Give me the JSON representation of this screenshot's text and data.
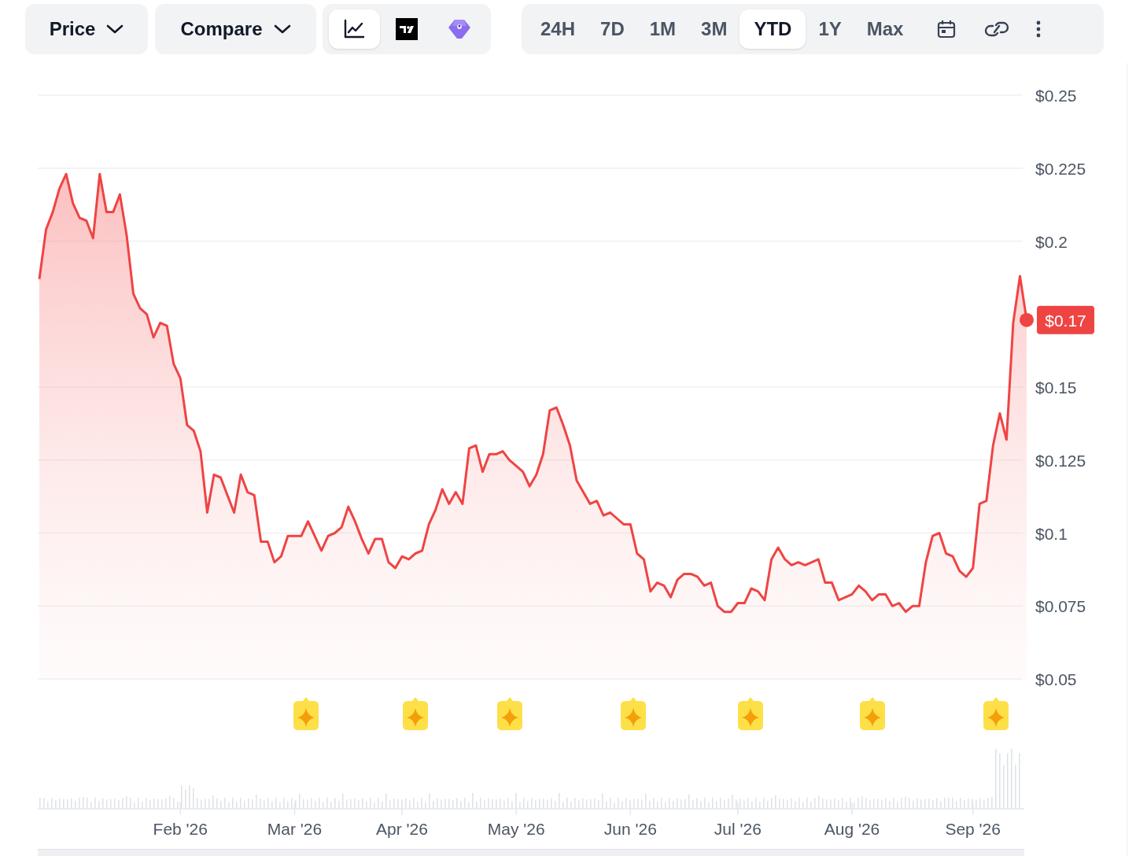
{
  "toolbar": {
    "price_dropdown": {
      "label": "Price"
    },
    "compare_dropdown": {
      "label": "Compare"
    },
    "view_modes": [
      {
        "selected": true
      },
      {
        "selected": false
      },
      {
        "selected": false
      }
    ],
    "ranges": [
      {
        "label": "24H",
        "selected": false
      },
      {
        "label": "7D",
        "selected": false
      },
      {
        "label": "1M",
        "selected": false
      },
      {
        "label": "3M",
        "selected": false
      },
      {
        "label": "YTD",
        "selected": true
      },
      {
        "label": "1Y",
        "selected": false
      },
      {
        "label": "Max",
        "selected": false
      }
    ]
  },
  "chart": {
    "current_price_label": "$0.17",
    "chart_data": {
      "type": "area",
      "grid": true,
      "ylim": [
        0.05,
        0.25
      ],
      "yticks": [
        {
          "value": 0.05,
          "label": "$0.05"
        },
        {
          "value": 0.075,
          "label": "$0.075"
        },
        {
          "value": 0.1,
          "label": "$0.1"
        },
        {
          "value": 0.125,
          "label": "$0.125"
        },
        {
          "value": 0.15,
          "label": "$0.15"
        },
        {
          "value": 0.2,
          "label": "$0.2"
        },
        {
          "value": 0.225,
          "label": "$0.225"
        },
        {
          "value": 0.25,
          "label": "$0.25"
        }
      ],
      "categories": [
        null,
        null,
        null,
        null,
        null,
        null,
        null,
        null,
        null,
        null,
        null,
        null,
        null,
        null,
        null,
        null,
        null,
        null,
        null,
        null,
        null,
        "Feb '26",
        null,
        null,
        null,
        null,
        null,
        null,
        null,
        null,
        null,
        null,
        null,
        null,
        null,
        null,
        null,
        null,
        "Mar '26",
        null,
        null,
        null,
        null,
        null,
        null,
        null,
        null,
        null,
        null,
        null,
        null,
        null,
        null,
        null,
        "Apr '26",
        null,
        null,
        null,
        null,
        null,
        null,
        null,
        null,
        null,
        null,
        null,
        null,
        null,
        null,
        null,
        null,
        "May '26",
        null,
        null,
        null,
        null,
        null,
        null,
        null,
        null,
        null,
        null,
        null,
        null,
        null,
        null,
        null,
        null,
        "Jun '26",
        null,
        null,
        null,
        null,
        null,
        null,
        null,
        null,
        null,
        null,
        null,
        null,
        null,
        null,
        null,
        "Jul '26",
        null,
        null,
        null,
        null,
        null,
        null,
        null,
        null,
        null,
        null,
        null,
        null,
        null,
        null,
        null,
        null,
        "Aug '26",
        null,
        null,
        null,
        null,
        null,
        null,
        null,
        null,
        null,
        null,
        null,
        null,
        null,
        null,
        null,
        null,
        null,
        "Sep '26",
        null,
        null,
        null,
        null,
        null,
        null,
        null,
        null
      ],
      "series": [
        {
          "color": "#ef4444",
          "values": [
            0.187,
            0.204,
            0.21,
            0.218,
            0.223,
            0.213,
            0.208,
            0.207,
            0.201,
            0.223,
            0.21,
            0.21,
            0.216,
            0.202,
            0.182,
            0.177,
            0.175,
            0.167,
            0.172,
            0.171,
            0.158,
            0.153,
            0.137,
            0.135,
            0.128,
            0.107,
            0.12,
            0.119,
            0.113,
            0.107,
            0.12,
            0.114,
            0.113,
            0.097,
            0.097,
            0.09,
            0.092,
            0.099,
            0.099,
            0.099,
            0.104,
            0.099,
            0.094,
            0.099,
            0.1,
            0.102,
            0.109,
            0.104,
            0.098,
            0.093,
            0.098,
            0.098,
            0.09,
            0.088,
            0.092,
            0.091,
            0.093,
            0.094,
            0.103,
            0.108,
            0.115,
            0.11,
            0.114,
            0.11,
            0.129,
            0.13,
            0.121,
            0.127,
            0.127,
            0.128,
            0.125,
            0.123,
            0.121,
            0.116,
            0.12,
            0.127,
            0.142,
            0.143,
            0.137,
            0.13,
            0.118,
            0.114,
            0.11,
            0.111,
            0.106,
            0.107,
            0.105,
            0.103,
            0.103,
            0.093,
            0.091,
            0.08,
            0.083,
            0.082,
            0.078,
            0.084,
            0.086,
            0.086,
            0.085,
            0.082,
            0.083,
            0.075,
            0.073,
            0.073,
            0.076,
            0.076,
            0.081,
            0.08,
            0.077,
            0.091,
            0.095,
            0.091,
            0.089,
            0.09,
            0.089,
            0.09,
            0.091,
            0.083,
            0.083,
            0.077,
            0.078,
            0.079,
            0.082,
            0.08,
            0.077,
            0.079,
            0.079,
            0.075,
            0.076,
            0.073,
            0.075,
            0.075,
            0.09,
            0.099,
            0.1,
            0.093,
            0.092,
            0.087,
            0.085,
            0.088,
            0.11,
            0.111,
            0.13,
            0.141,
            0.132,
            0.172,
            0.188,
            0.173
          ]
        }
      ]
    }
  }
}
